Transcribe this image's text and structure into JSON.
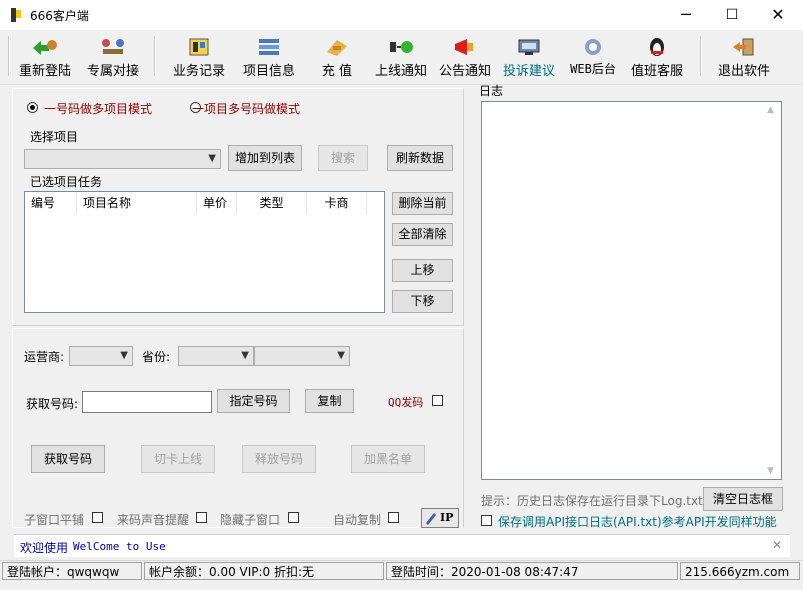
{
  "window": {
    "title": "666客户端",
    "minimize": "─",
    "maximize": "☐",
    "close": "✕"
  },
  "toolbar": [
    {
      "label": "重新登陆"
    },
    {
      "label": "专属对接"
    },
    {
      "label": "业务记录"
    },
    {
      "label": "项目信息"
    },
    {
      "label": "充  值"
    },
    {
      "label": "上线通知"
    },
    {
      "label": "公告通知"
    },
    {
      "label": "投诉建议"
    },
    {
      "label": "WEB后台"
    },
    {
      "label": "值班客服"
    },
    {
      "label": "退出软件"
    }
  ],
  "mode": {
    "option1": "一号码做多项目模式",
    "option2": "一项目多号码做模式",
    "selected": 1
  },
  "project": {
    "select_label": "选择项目",
    "add_button": "增加到列表",
    "search_button": "搜索",
    "refresh_button": "刷新数据",
    "tasks_label": "已选项目任务",
    "columns": [
      "编号",
      "项目名称",
      "单价",
      "类型",
      "卡商"
    ],
    "delete_button": "删除当前",
    "clear_button": "全部清除",
    "up_button": "上移",
    "down_button": "下移"
  },
  "filters": {
    "operator_label": "运营商:",
    "province_label": "省份:"
  },
  "number": {
    "get_label": "获取号码:",
    "input_value": "",
    "assign_button": "指定号码",
    "copy_button": "复制",
    "qq_label": "QQ发码",
    "get_button": "获取号码",
    "switch_button": "切卡上线",
    "release_button": "释放号码",
    "blacklist_button": "加黑名单"
  },
  "options": {
    "tile": "子窗口平铺",
    "sound": "来码声音提醒",
    "hide": "隐藏子窗口",
    "auto_copy": "自动复制",
    "ip_badge": "IP"
  },
  "log": {
    "label": "日志",
    "hint": "提示：历史日志保存在运行目录下Log.txt",
    "clear_button": "清空日志框",
    "api_log": "保存调用API接口日志(API.txt)参考API开发同样功能"
  },
  "welcome": {
    "cn": "欢迎使用",
    "en": "WelCome to Use",
    "close": "✕"
  },
  "status": {
    "account": "登陆帐户：qwqwqw",
    "balance": "帐户余额：0.00  VIP:0 折扣:无",
    "login_time": "登陆时间：2020-01-08 08:47:47",
    "server": "215.666yzm.com"
  },
  "colors": {
    "accent_red": "#8b0000",
    "teal": "#00707a",
    "blue": "#0000a0"
  }
}
